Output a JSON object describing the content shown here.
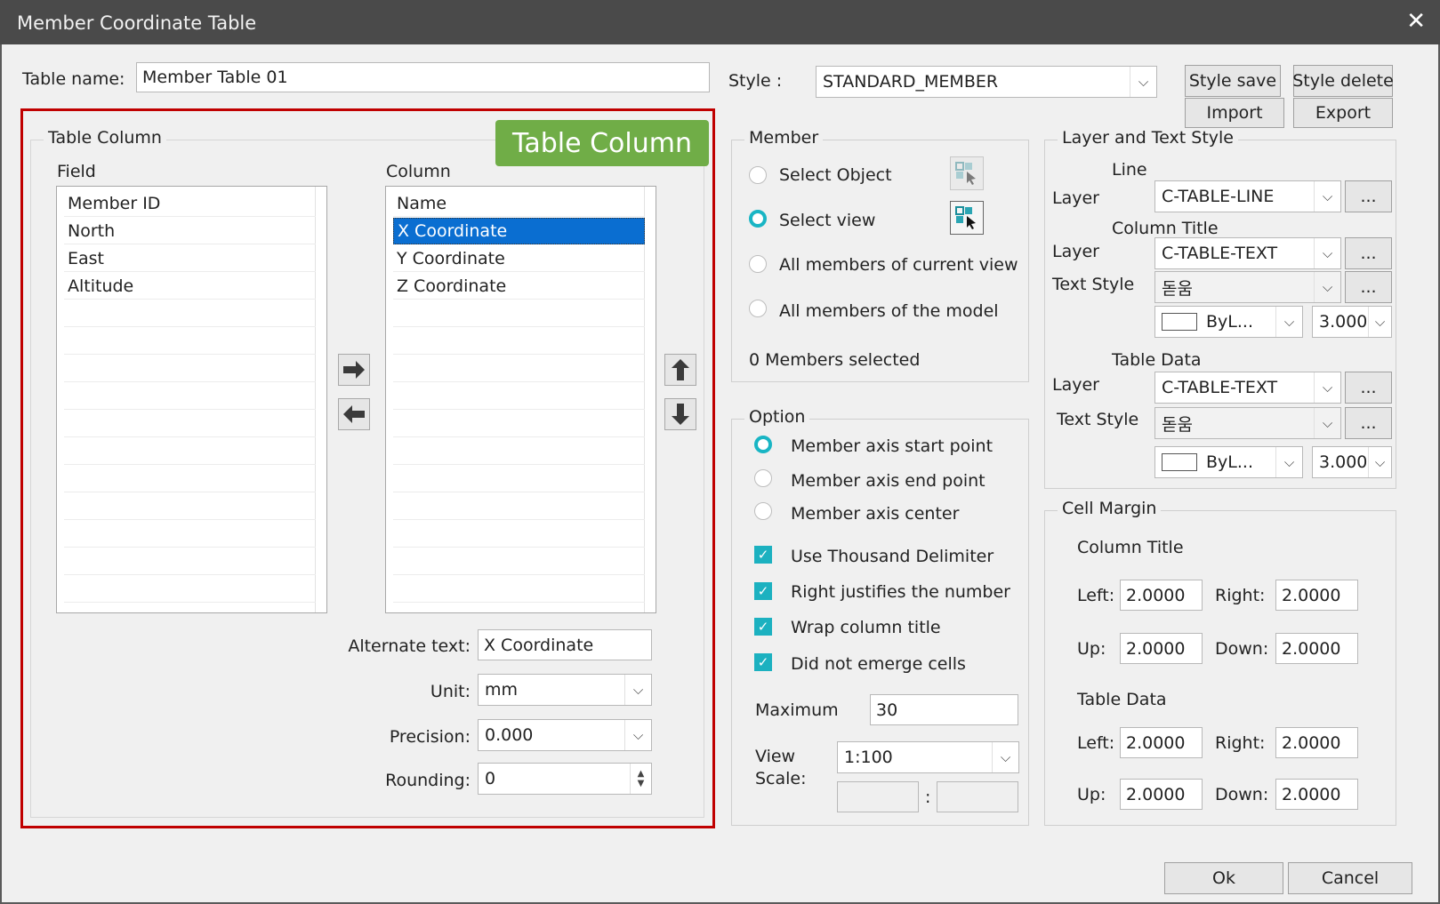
{
  "window": {
    "title": "Member Coordinate Table",
    "close_glyph": "✕"
  },
  "table_name": {
    "label": "Table name:",
    "value": "Member Table 01"
  },
  "style": {
    "label": "Style :",
    "value": "STANDARD_MEMBER"
  },
  "buttons": {
    "style_save": "Style save",
    "style_delete": "Style delete",
    "import": "Import",
    "export": "Export",
    "ok": "Ok",
    "cancel": "Cancel",
    "ellipsis": "..."
  },
  "table_column": {
    "group_title": "Table Column",
    "callout": "Table Column",
    "field_header": "Field",
    "column_header": "Column",
    "fields": [
      "Member ID",
      "North",
      "East",
      "Altitude"
    ],
    "columns": [
      "Name",
      "X Coordinate",
      "Y Coordinate",
      "Z Coordinate"
    ],
    "selected_column": "X Coordinate",
    "alternate_text": {
      "label": "Alternate text:",
      "value": "X Coordinate"
    },
    "unit": {
      "label": "Unit:",
      "value": "mm"
    },
    "precision": {
      "label": "Precision:",
      "value": "0.000"
    },
    "rounding": {
      "label": "Rounding:",
      "value": "0"
    }
  },
  "member": {
    "group_title": "Member",
    "options": [
      "Select Object",
      "Select view",
      "All members of current view",
      "All members of the model"
    ],
    "selected": "Select view",
    "status": "0 Members selected"
  },
  "option": {
    "group_title": "Option",
    "radios": [
      "Member axis start point",
      "Member axis end point",
      "Member axis center"
    ],
    "selected_radio": "Member axis start point",
    "checks": [
      "Use Thousand Delimiter",
      "Right justifies the number",
      "Wrap column title",
      "Did not emerge cells"
    ],
    "maximum": {
      "label": "Maximum",
      "value": "30"
    },
    "view_scale": {
      "label1": "View",
      "label2": "Scale:",
      "value": "1:100",
      "sep": ":"
    }
  },
  "layer_text": {
    "group_title": "Layer and Text Style",
    "line_title": "Line",
    "column_title": "Column Title",
    "table_data": "Table Data",
    "layer_label": "Layer",
    "text_style_label": "Text Style",
    "line_layer": "C-TABLE-LINE",
    "ct_layer": "C-TABLE-TEXT",
    "ct_text_style": "돋움",
    "ct_color": "ByL...",
    "ct_height": "3.0000",
    "td_layer": "C-TABLE-TEXT",
    "td_text_style": "돋움",
    "td_color": "ByL...",
    "td_height": "3.0000"
  },
  "cell_margin": {
    "group_title": "Cell Margin",
    "column_title": "Column Title",
    "table_data": "Table Data",
    "left_label": "Left:",
    "right_label": "Right:",
    "up_label": "Up:",
    "down_label": "Down:",
    "ct": {
      "left": "2.0000",
      "right": "2.0000",
      "up": "2.0000",
      "down": "2.0000"
    },
    "td": {
      "left": "2.0000",
      "right": "2.0000",
      "up": "2.0000",
      "down": "2.0000"
    }
  },
  "colors": {
    "highlight_border": "#c00000",
    "callout_bg": "#70ad47",
    "selection": "#0a6ed1",
    "accent": "#19b5c4"
  }
}
